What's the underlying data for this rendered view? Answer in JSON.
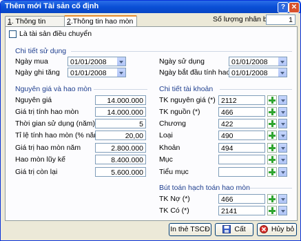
{
  "window": {
    "title": "Thêm mới Tài sản cố định"
  },
  "header": {
    "quantity_label": "Số lượng nhân bản",
    "quantity_value": "1"
  },
  "tabs": [
    {
      "key": "1",
      "label": "Thông tin chung"
    },
    {
      "key": "2",
      "label": "Thông tin hao mòn"
    }
  ],
  "transfer_checkbox": {
    "label": "Là tài sản điều chuyển",
    "checked": false
  },
  "usage": {
    "section": "Chi tiết sử dụng",
    "purchase_date_label": "Ngày mua",
    "purchase_date": "01/01/2008",
    "increase_date_label": "Ngày ghi tăng",
    "increase_date": "01/01/2008",
    "use_date_label": "Ngày sử dụng",
    "use_date": "01/01/2008",
    "depr_start_label": "Ngày bắt đầu tính hao mòn",
    "depr_start": "01/01/2008"
  },
  "cost": {
    "section": "Nguyên giá và hao mòn",
    "rows": [
      {
        "label": "Nguyên giá",
        "value": "14.000.000"
      },
      {
        "label": "Giá trị tính hao mòn",
        "value": "14.000.000"
      },
      {
        "label": "Thời gian sử dụng (năm)",
        "value": "5"
      },
      {
        "label": "Tỉ lệ tính hao mòn (% năm)",
        "value": "20,00"
      },
      {
        "label": "Giá trị hao mòn năm",
        "value": "2.800.000"
      },
      {
        "label": "Hao mòn lũy kế",
        "value": "8.400.000"
      },
      {
        "label": "Giá trị còn lại",
        "value": "5.600.000"
      }
    ]
  },
  "accounts": {
    "section": "Chi tiết tài khoản",
    "rows": [
      {
        "label": "TK nguyên giá (*)",
        "value": "2112"
      },
      {
        "label": "TK nguồn (*)",
        "value": "466"
      },
      {
        "label": "Chương",
        "value": "422"
      },
      {
        "label": "Loại",
        "value": "490"
      },
      {
        "label": "Khoản",
        "value": "494"
      },
      {
        "label": "Mục",
        "value": ""
      },
      {
        "label": "Tiểu mục",
        "value": ""
      }
    ]
  },
  "entry": {
    "section": "Bút toán hạch toán hao mòn",
    "rows": [
      {
        "label": "TK Nợ (*)",
        "value": "466"
      },
      {
        "label": "TK Có (*)",
        "value": "2141"
      }
    ]
  },
  "buttons": {
    "print": "In thẻ TSCĐ",
    "save": "Cất",
    "cancel": "Hủy bỏ"
  },
  "colors": {
    "title_bar": "#0a4fd6",
    "section_text": "#1f3f8f",
    "plus": "#2fa52f",
    "cancel_icon": "#d9302b"
  }
}
